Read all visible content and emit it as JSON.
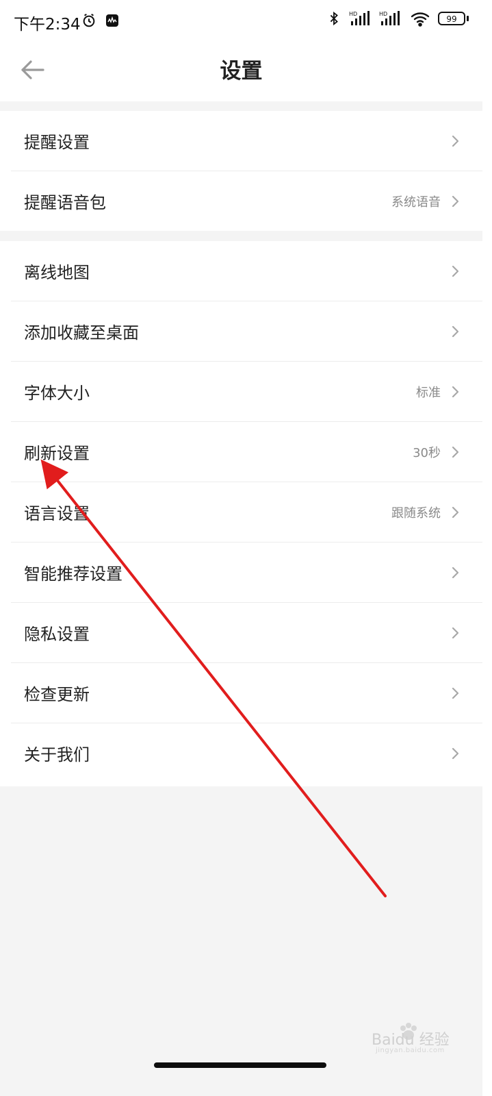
{
  "status_bar": {
    "time": "下午2:34",
    "left_icons": [
      "alarm-icon",
      "app-notification-icon"
    ],
    "right_icons": [
      "bluetooth-icon",
      "hd-signal-icon",
      "hd-signal-icon",
      "wifi-icon"
    ],
    "battery": "99"
  },
  "header": {
    "title": "设置",
    "back_icon": "back-arrow-icon"
  },
  "groups": [
    {
      "items": [
        {
          "label": "提醒设置",
          "value": ""
        },
        {
          "label": "提醒语音包",
          "value": "系统语音"
        }
      ]
    },
    {
      "items": [
        {
          "label": "离线地图",
          "value": ""
        },
        {
          "label": "添加收藏至桌面",
          "value": ""
        },
        {
          "label": "字体大小",
          "value": "标准"
        },
        {
          "label": "刷新设置",
          "value": "30秒"
        },
        {
          "label": "语言设置",
          "value": "跟随系统"
        },
        {
          "label": "智能推荐设置",
          "value": ""
        },
        {
          "label": "隐私设置",
          "value": ""
        },
        {
          "label": "检查更新",
          "value": ""
        },
        {
          "label": "关于我们",
          "value": ""
        }
      ]
    }
  ],
  "annotation": {
    "color": "#e11d1d",
    "target": "刷新设置"
  },
  "watermark": {
    "text": "Baidu 经验",
    "subtext": "jingyan.baidu.com"
  },
  "colors": {
    "background": "#f4f4f4",
    "card": "#ffffff",
    "primary_text": "#222222",
    "secondary_text": "#8a8a8a",
    "divider": "#ececec"
  }
}
